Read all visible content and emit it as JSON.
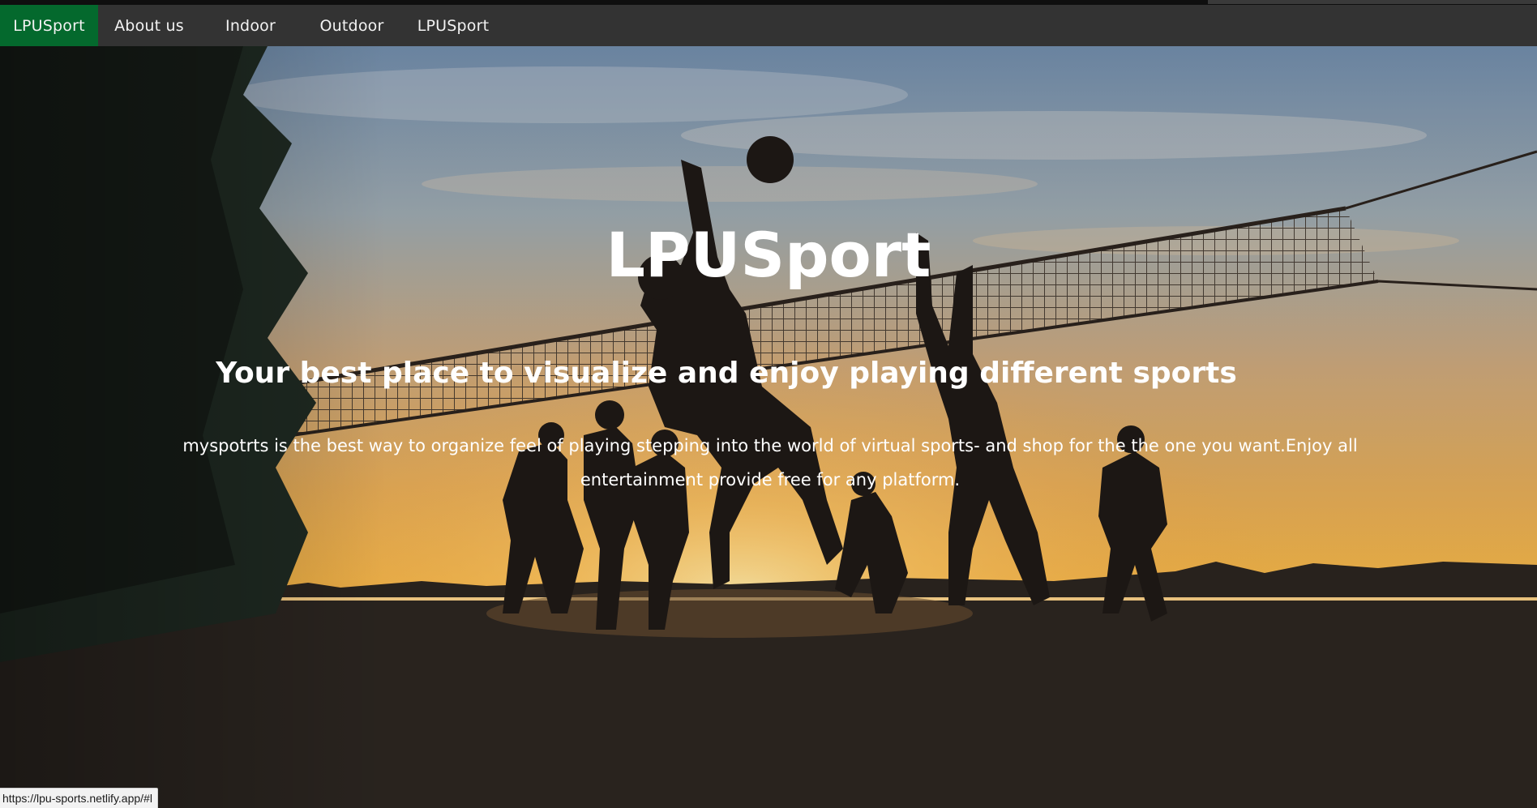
{
  "nav": {
    "items": [
      {
        "label": "LPUSport",
        "active": true
      },
      {
        "label": "About us",
        "active": false
      },
      {
        "label": "Indoor",
        "active": false
      },
      {
        "label": "Outdoor",
        "active": false
      },
      {
        "label": "LPUSport",
        "active": false
      }
    ],
    "active_color": "#04692d",
    "bar_color": "#333333"
  },
  "hero": {
    "title": "LPUSport",
    "subtitle": "Your best place to visualize and enjoy playing different sports",
    "text": "myspotrts is the best way to organize feel of playing stepping into the world of virtual sports- and shop for the the one you want.Enjoy all entertainment provide free for any platform."
  },
  "status_bar": {
    "url": "https://lpu-sports.netlify.app/#l"
  }
}
